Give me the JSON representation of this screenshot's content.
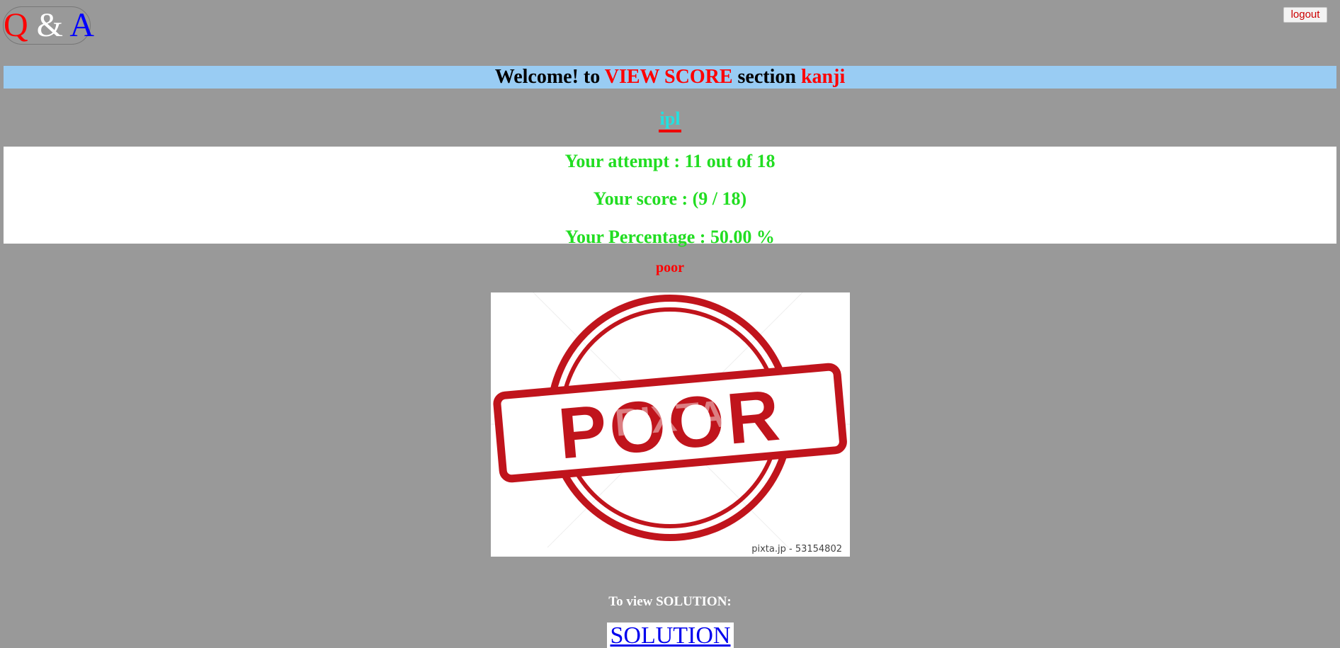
{
  "logo": {
    "q": "Q",
    "amp": "&",
    "a": "A"
  },
  "header": {
    "logout_label": "logout"
  },
  "welcome": {
    "prefix": "Welcome! to",
    "section": "VIEW SCORE",
    "middle": "section",
    "username": "kanji"
  },
  "quiz": {
    "name": "ipl"
  },
  "results": {
    "attempt": "Your attempt : 11 out of 18",
    "score": "Your score : (9 / 18)",
    "percentage": "Your Percentage : 50.00 %"
  },
  "grade": {
    "label": "poor"
  },
  "image": {
    "stamp_text": "POOR",
    "watermark": "PIXTA",
    "credit": "pixta.jp - 53154802",
    "stamp_color": "#c0141c"
  },
  "solution": {
    "prompt": "To view SOLUTION:",
    "link_label": "SOLUTION"
  },
  "colors": {
    "background": "#999999",
    "welcome_bar": "#99ccf3",
    "results_text": "#22dd22",
    "quiz_name": "#22e0e0",
    "accent_red": "#ff0000",
    "link_blue": "#0000ee"
  }
}
